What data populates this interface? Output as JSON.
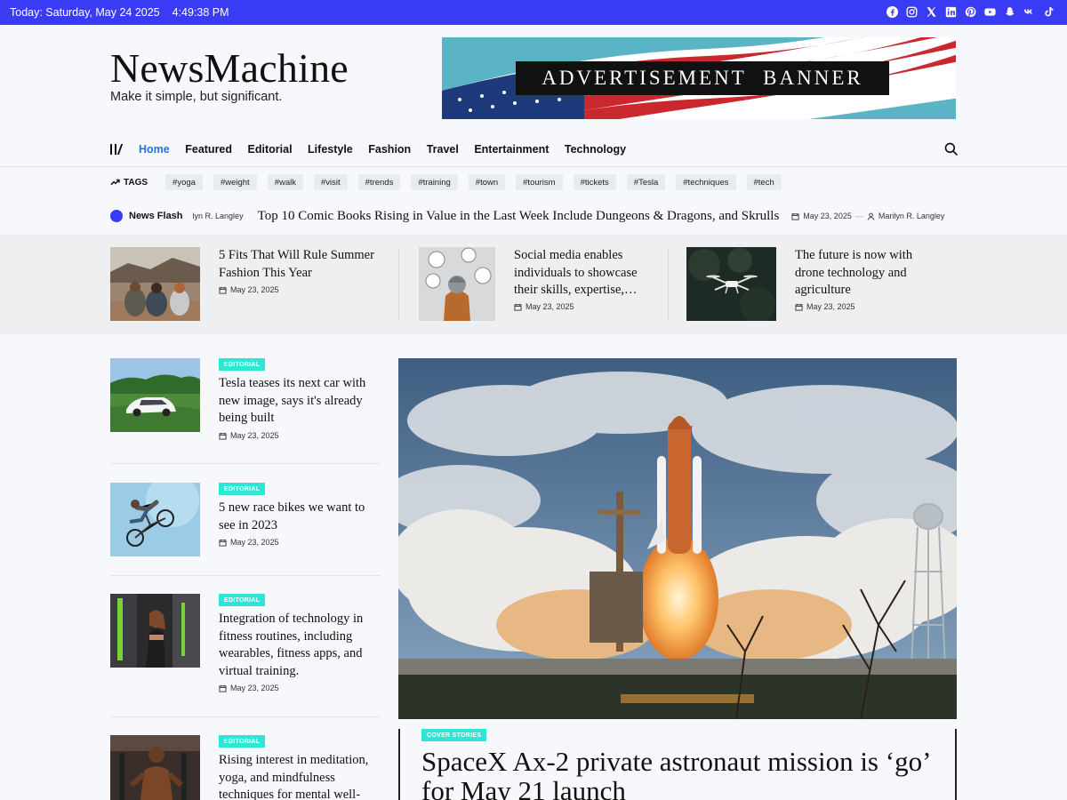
{
  "topbar": {
    "date": "Today: Saturday, May 24 2025",
    "time": "4:49:38 PM",
    "social_icons": [
      "facebook-icon",
      "instagram-icon",
      "x-icon",
      "linkedin-icon",
      "pinterest-icon",
      "youtube-icon",
      "snapchat-icon",
      "vk-icon",
      "tiktok-icon"
    ]
  },
  "header": {
    "site_title": "NewsMachine",
    "tagline": "Make it simple, but significant.",
    "banner_text": "ADVERTISEMENT BANNER"
  },
  "nav": {
    "items": [
      "Home",
      "Featured",
      "Editorial",
      "Lifestyle",
      "Fashion",
      "Travel",
      "Entertainment",
      "Technology"
    ],
    "active": "Home"
  },
  "tags": {
    "label": "TAGS",
    "items": [
      "#yoga",
      "#weight",
      "#walk",
      "#visit",
      "#trends",
      "#training",
      "#town",
      "#tourism",
      "#tickets",
      "#Tesla",
      "#techniques",
      "#tech"
    ]
  },
  "news_flash": {
    "label": "News Flash",
    "prev_author": "lyn R. Langley",
    "headline": "Top 10 Comic Books Rising in Value in the Last Week Include Dungeons & Dragons, and Skrulls",
    "date": "May 23, 2025",
    "author": "Marilyn R. Langley"
  },
  "strip": [
    {
      "title": "5 Fits That Will Rule Summer Fashion This Year",
      "date": "May 23, 2025"
    },
    {
      "title": "Social media enables individuals to showcase their skills, expertise,…",
      "date": "May 23, 2025"
    },
    {
      "title": "The future is now with drone technology and agriculture",
      "date": "May 23, 2025"
    }
  ],
  "left_list": [
    {
      "badge": "EDITORIAL",
      "title": "Tesla teases its next car with new image, says it's already being built",
      "date": "May 23, 2025"
    },
    {
      "badge": "EDITORIAL",
      "title": "5 new race bikes we want to see in 2023",
      "date": "May 23, 2025"
    },
    {
      "badge": "EDITORIAL",
      "title": "Integration of technology in fitness routines, including wearables, fitness apps, and virtual training.",
      "date": "May 23, 2025"
    },
    {
      "badge": "EDITORIAL",
      "title": "Rising interest in meditation, yoga, and mindfulness techniques for mental well-",
      "date": ""
    }
  ],
  "featured": {
    "badge": "COVER STORIES",
    "title": "SpaceX Ax-2 private astronaut mission is ‘go’ for May 21 launch"
  },
  "colors": {
    "accent": "#3a3bf4",
    "nav_active": "#2c6fe6",
    "badge": "#2ee6d6"
  }
}
